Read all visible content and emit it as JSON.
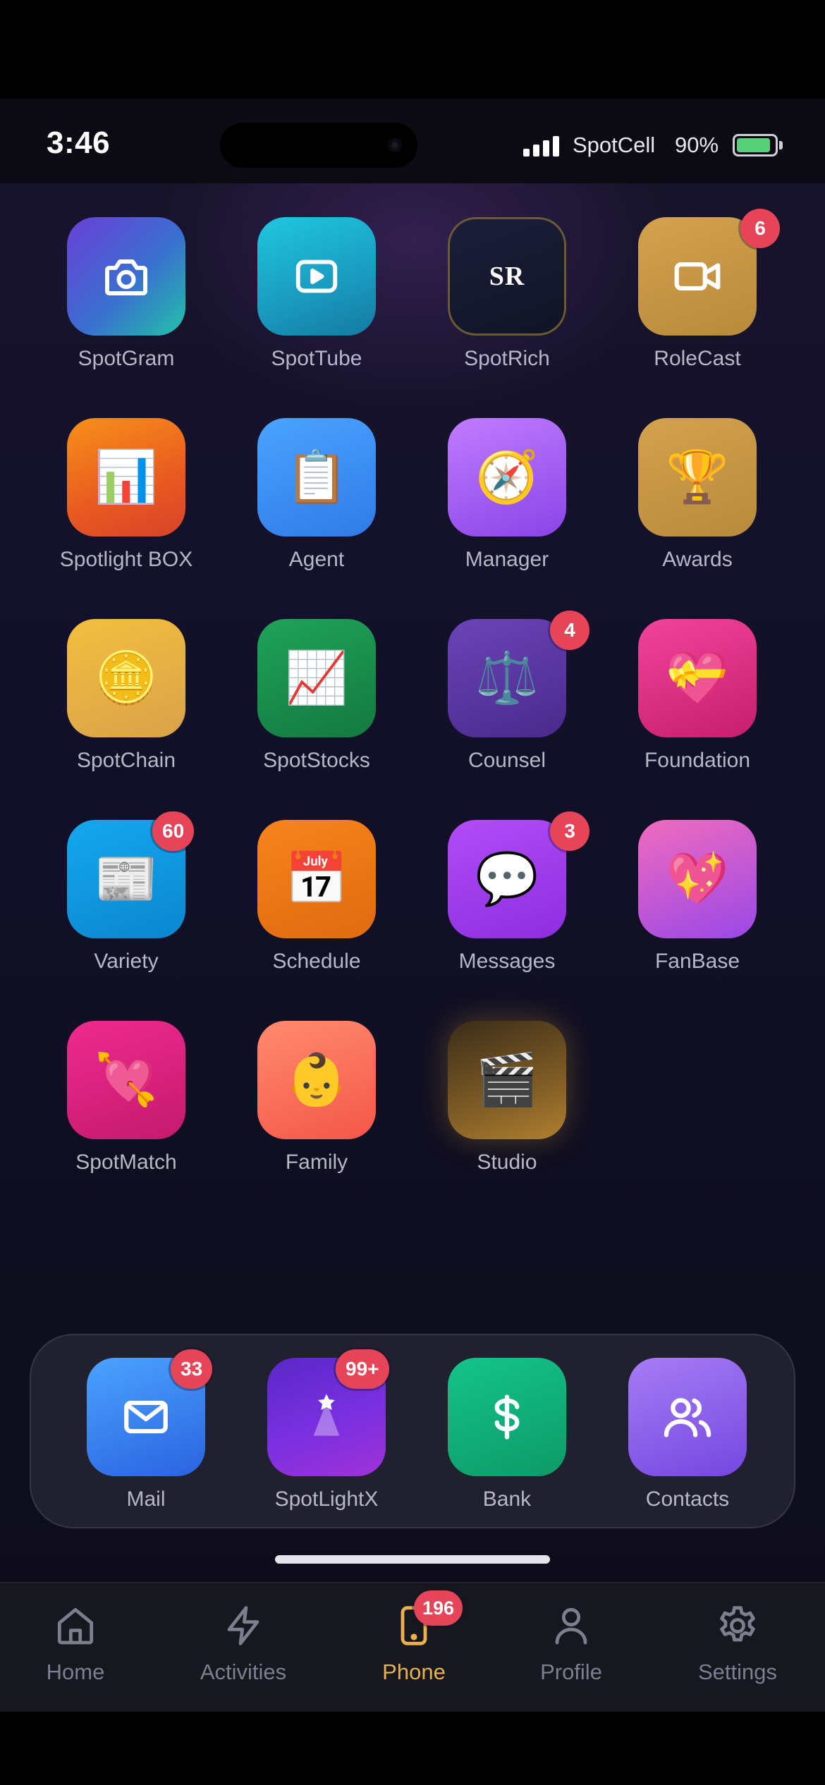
{
  "status_bar": {
    "time": "3:46",
    "carrier": "SpotCell",
    "battery_percent": "90%",
    "battery_level": 0.9,
    "signal_bars": 4
  },
  "home_screen": {
    "apps": [
      {
        "label": "SpotGram",
        "icon": "camera-icon"
      },
      {
        "label": "SpotTube",
        "icon": "play-icon"
      },
      {
        "label": "SpotRich",
        "icon": "sr-monogram",
        "icon_text": "SR"
      },
      {
        "label": "RoleCast",
        "icon": "video-camera-icon",
        "badge": "6"
      },
      {
        "label": "Spotlight BOX",
        "icon": "bar-chart-icon",
        "glyph": "📊"
      },
      {
        "label": "Agent",
        "icon": "clipboard-icon",
        "glyph": "📋"
      },
      {
        "label": "Manager",
        "icon": "compass-icon",
        "glyph": "🧭"
      },
      {
        "label": "Awards",
        "icon": "trophy-icon",
        "glyph": "🏆"
      },
      {
        "label": "SpotChain",
        "icon": "coin-icon",
        "glyph": "🪙"
      },
      {
        "label": "SpotStocks",
        "icon": "chart-increasing-icon",
        "glyph": "📈"
      },
      {
        "label": "Counsel",
        "icon": "scales-icon",
        "glyph": "⚖️",
        "badge": "4"
      },
      {
        "label": "Foundation",
        "icon": "heart-ribbon-icon",
        "glyph": "💝"
      },
      {
        "label": "Variety",
        "icon": "newspaper-icon",
        "glyph": "📰",
        "badge": "60"
      },
      {
        "label": "Schedule",
        "icon": "calendar-icon",
        "glyph": "📅"
      },
      {
        "label": "Messages",
        "icon": "speech-bubble-icon",
        "glyph": "💬",
        "badge": "3"
      },
      {
        "label": "FanBase",
        "icon": "sparkling-heart-icon",
        "glyph": "💖"
      },
      {
        "label": "SpotMatch",
        "icon": "heart-arrow-icon",
        "glyph": "💘"
      },
      {
        "label": "Family",
        "icon": "baby-icon",
        "glyph": "👶"
      },
      {
        "label": "Studio",
        "icon": "clapper-board-icon",
        "glyph": "🎬"
      }
    ]
  },
  "dock": {
    "apps": [
      {
        "label": "Mail",
        "icon": "envelope-icon",
        "badge": "33"
      },
      {
        "label": "SpotLightX",
        "icon": "spotlight-star-icon",
        "badge": "99+"
      },
      {
        "label": "Bank",
        "icon": "dollar-icon"
      },
      {
        "label": "Contacts",
        "icon": "users-icon"
      }
    ]
  },
  "tab_bar": {
    "tabs": [
      {
        "label": "Home",
        "icon": "home-icon"
      },
      {
        "label": "Activities",
        "icon": "lightning-icon"
      },
      {
        "label": "Phone",
        "icon": "phone-device-icon",
        "badge": "196",
        "active": true
      },
      {
        "label": "Profile",
        "icon": "person-icon"
      },
      {
        "label": "Settings",
        "icon": "gear-icon"
      }
    ]
  },
  "colors": {
    "badge": "#e64458",
    "active_tab": "#e8b14e",
    "inactive_tab": "#7e7e8e",
    "label": "#b7b7c8",
    "battery": "#58d07a"
  }
}
